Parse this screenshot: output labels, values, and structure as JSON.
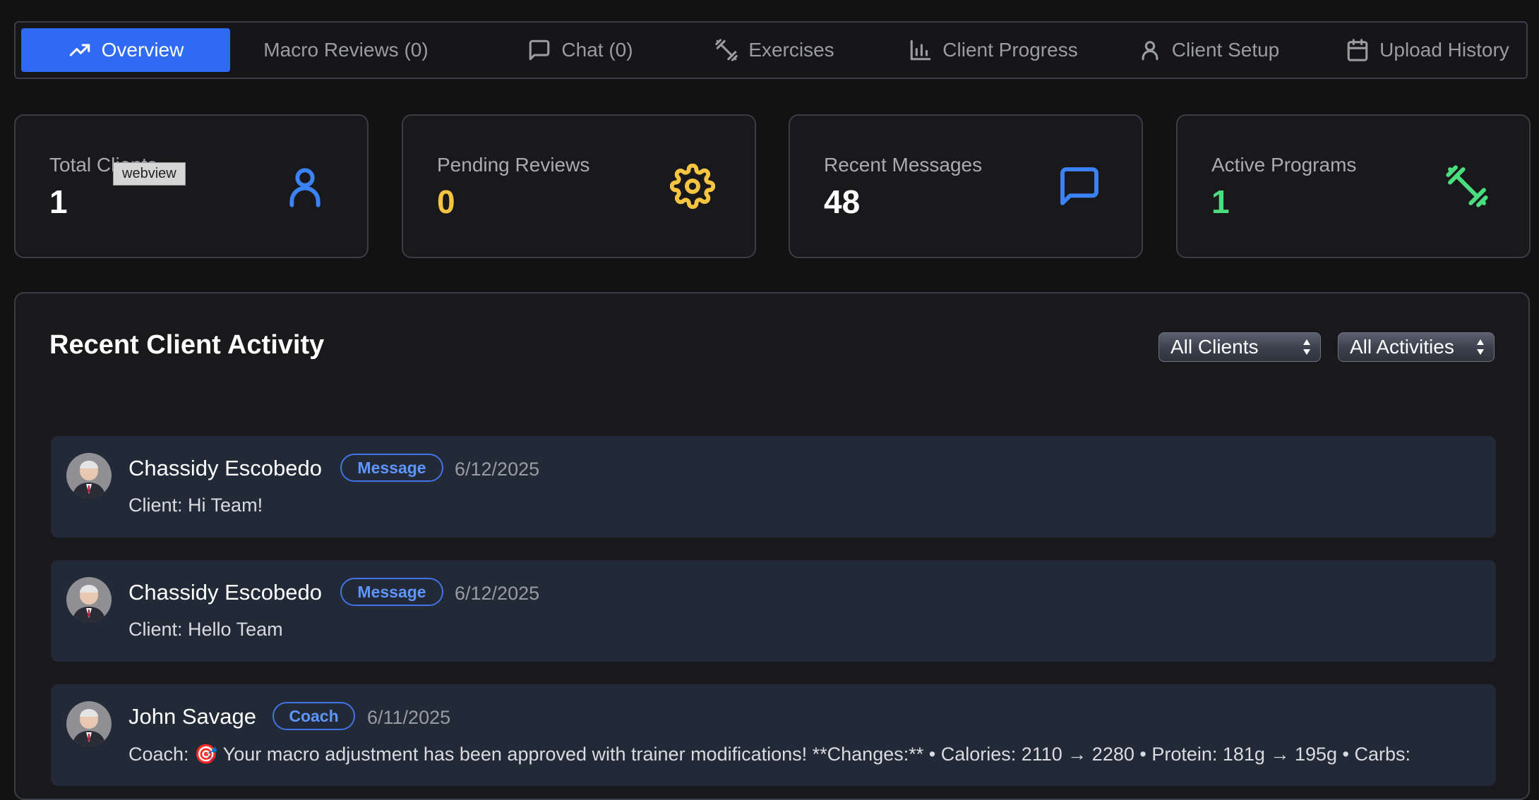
{
  "tabs": [
    {
      "label": "Overview",
      "icon": "trending-up-icon",
      "active": true
    },
    {
      "label": "Macro Reviews (0)",
      "icon": "",
      "active": false
    },
    {
      "label": "Chat (0)",
      "icon": "message-square-icon",
      "active": false
    },
    {
      "label": "Exercises",
      "icon": "dumbbell-icon",
      "active": false
    },
    {
      "label": "Client Progress",
      "icon": "bar-chart-icon",
      "active": false
    },
    {
      "label": "Client Setup",
      "icon": "user-icon",
      "active": false
    },
    {
      "label": "Upload History",
      "icon": "calendar-icon",
      "active": false
    }
  ],
  "stats": [
    {
      "label": "Total Clients",
      "value": "1",
      "color": "#ffffff",
      "icon": "user-icon",
      "icon_color": "#3b82f6"
    },
    {
      "label": "Pending Reviews",
      "value": "0",
      "color": "#f5c542",
      "icon": "gear-icon",
      "icon_color": "#f5c542"
    },
    {
      "label": "Recent Messages",
      "value": "48",
      "color": "#ffffff",
      "icon": "message-square-icon",
      "icon_color": "#3b82f6"
    },
    {
      "label": "Active Programs",
      "value": "1",
      "color": "#4ade80",
      "icon": "dumbbell-icon",
      "icon_color": "#4ade80"
    }
  ],
  "tooltip": "webview",
  "activity": {
    "title": "Recent Client Activity",
    "filters": {
      "clients": "All Clients",
      "activities": "All Activities"
    },
    "items": [
      {
        "name": "Chassidy Escobedo",
        "badge": "Message",
        "date": "6/12/2025",
        "text": "Client: Hi Team!"
      },
      {
        "name": "Chassidy Escobedo",
        "badge": "Message",
        "date": "6/12/2025",
        "text": "Client: Hello Team"
      },
      {
        "name": "John Savage",
        "badge": "Coach",
        "date": "6/11/2025",
        "text": "Coach: 🎯 Your macro adjustment has been approved with trainer modifications! **Changes:** • Calories: 2110 → 2280 • Protein: 181g → 195g • Carbs:"
      }
    ]
  },
  "colors": {
    "accent": "#2f6bf2",
    "background": "#121213",
    "card": "#19191b",
    "item": "#222a38"
  }
}
